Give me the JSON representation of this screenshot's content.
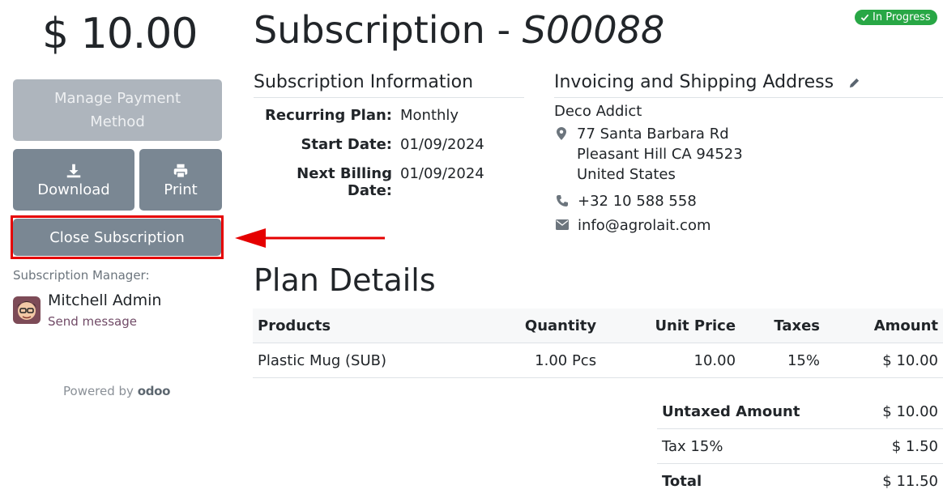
{
  "sidebar": {
    "price": "$ 10.00",
    "manage_payment_label": "Manage Payment Method",
    "download_label": "Download",
    "print_label": "Print",
    "close_subscription_label": "Close Subscription",
    "manager_label": "Subscription Manager:",
    "manager_name": "Mitchell Admin",
    "send_message_label": "Send message",
    "powered_by": "Powered by",
    "powered_brand": "odoo"
  },
  "header": {
    "title_prefix": "Subscription - ",
    "subscription_ref": "S00088",
    "status_badge": "In Progress"
  },
  "subscription_info": {
    "title": "Subscription Information",
    "recurring_plan_label": "Recurring Plan:",
    "recurring_plan_value": "Monthly",
    "start_date_label": "Start Date:",
    "start_date_value": "01/09/2024",
    "next_billing_label": "Next Billing Date:",
    "next_billing_value": "01/09/2024"
  },
  "address": {
    "title": "Invoicing and Shipping Address",
    "company": "Deco Addict",
    "street": "77 Santa Barbara Rd",
    "city": "Pleasant Hill CA 94523",
    "country": "United States",
    "phone": "+32 10 588 558",
    "email": "info@agrolait.com"
  },
  "plan": {
    "title": "Plan Details",
    "columns": [
      "Products",
      "Quantity",
      "Unit Price",
      "Taxes",
      "Amount"
    ],
    "rows": [
      {
        "product": "Plastic Mug (SUB)",
        "quantity": "1.00 Pcs",
        "unit_price": "10.00",
        "taxes": "15%",
        "amount": "$ 10.00"
      }
    ],
    "totals": {
      "untaxed_label": "Untaxed Amount",
      "untaxed_value": "$ 10.00",
      "tax_label": "Tax 15%",
      "tax_value": "$ 1.50",
      "total_label": "Total",
      "total_value": "$ 11.50"
    }
  },
  "colors": {
    "button": "#7a8793",
    "button_disabled": "#aeb5bd",
    "status_green": "#28a745",
    "highlight_red": "#e50000",
    "odoo_purple": "#714b67"
  },
  "icons": {
    "download": "download-icon",
    "print": "printer-icon",
    "status": "check-icon",
    "edit": "pencil-icon",
    "address": "map-marker-icon",
    "phone": "phone-icon",
    "email": "envelope-icon"
  }
}
